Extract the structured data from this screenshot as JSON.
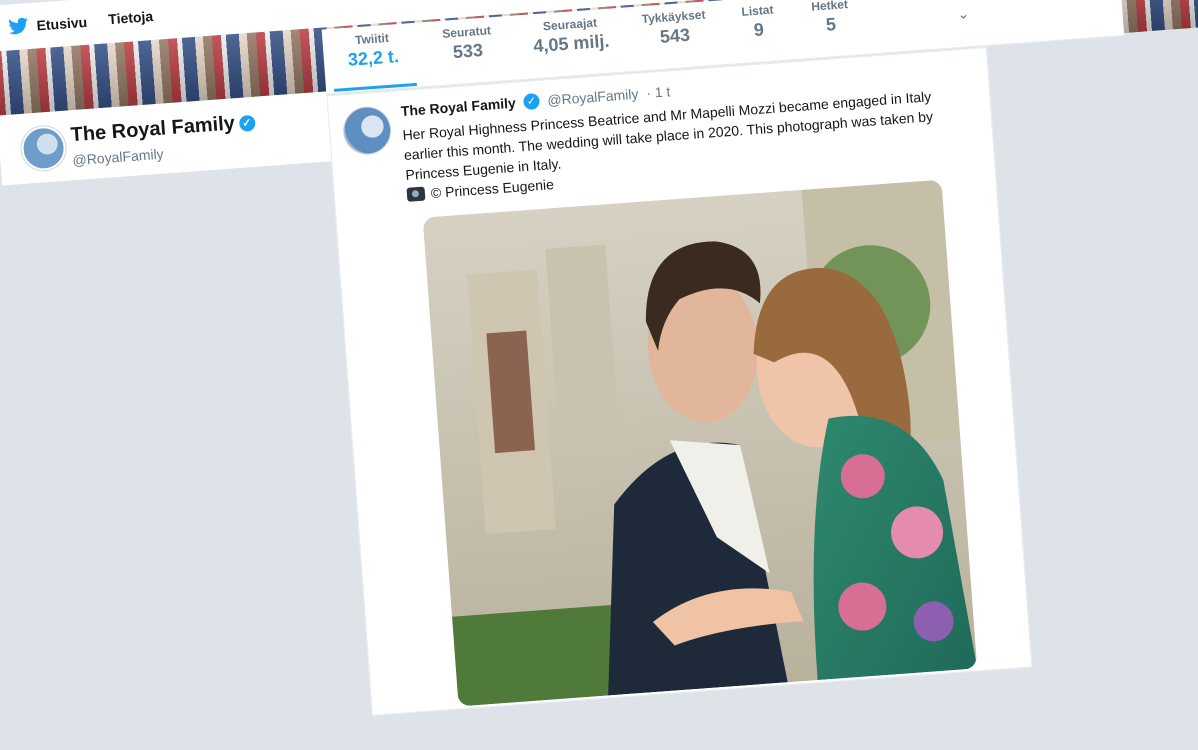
{
  "nav": {
    "home_label": "Etusivu",
    "about_label": "Tietoja"
  },
  "stats": [
    {
      "label": "Twiitit",
      "value": "32,2 t."
    },
    {
      "label": "Seuratut",
      "value": "533"
    },
    {
      "label": "Seuraajat",
      "value": "4,05 milj."
    },
    {
      "label": "Tykkäykset",
      "value": "543"
    },
    {
      "label": "Listat",
      "value": "9"
    },
    {
      "label": "Hetket",
      "value": "5"
    }
  ],
  "profile": {
    "name": "The Royal Family",
    "handle": "@RoyalFamily"
  },
  "tweet": {
    "author": "The Royal Family",
    "handle": "@RoyalFamily",
    "time": "· 1 t",
    "text": "Her Royal Highness Princess Beatrice and Mr Mapelli Mozzi became engaged in Italy earlier this month. The wedding will take place in 2020. This photograph was taken by Princess Eugenie in Italy.",
    "credit": "© Princess Eugenie"
  },
  "colors": {
    "accent": "#1da1f2",
    "muted": "#657786",
    "text": "#14171a"
  },
  "icons": [
    "twitter-bird-icon",
    "verified-badge-icon",
    "chevron-down-icon",
    "camera-icon"
  ]
}
